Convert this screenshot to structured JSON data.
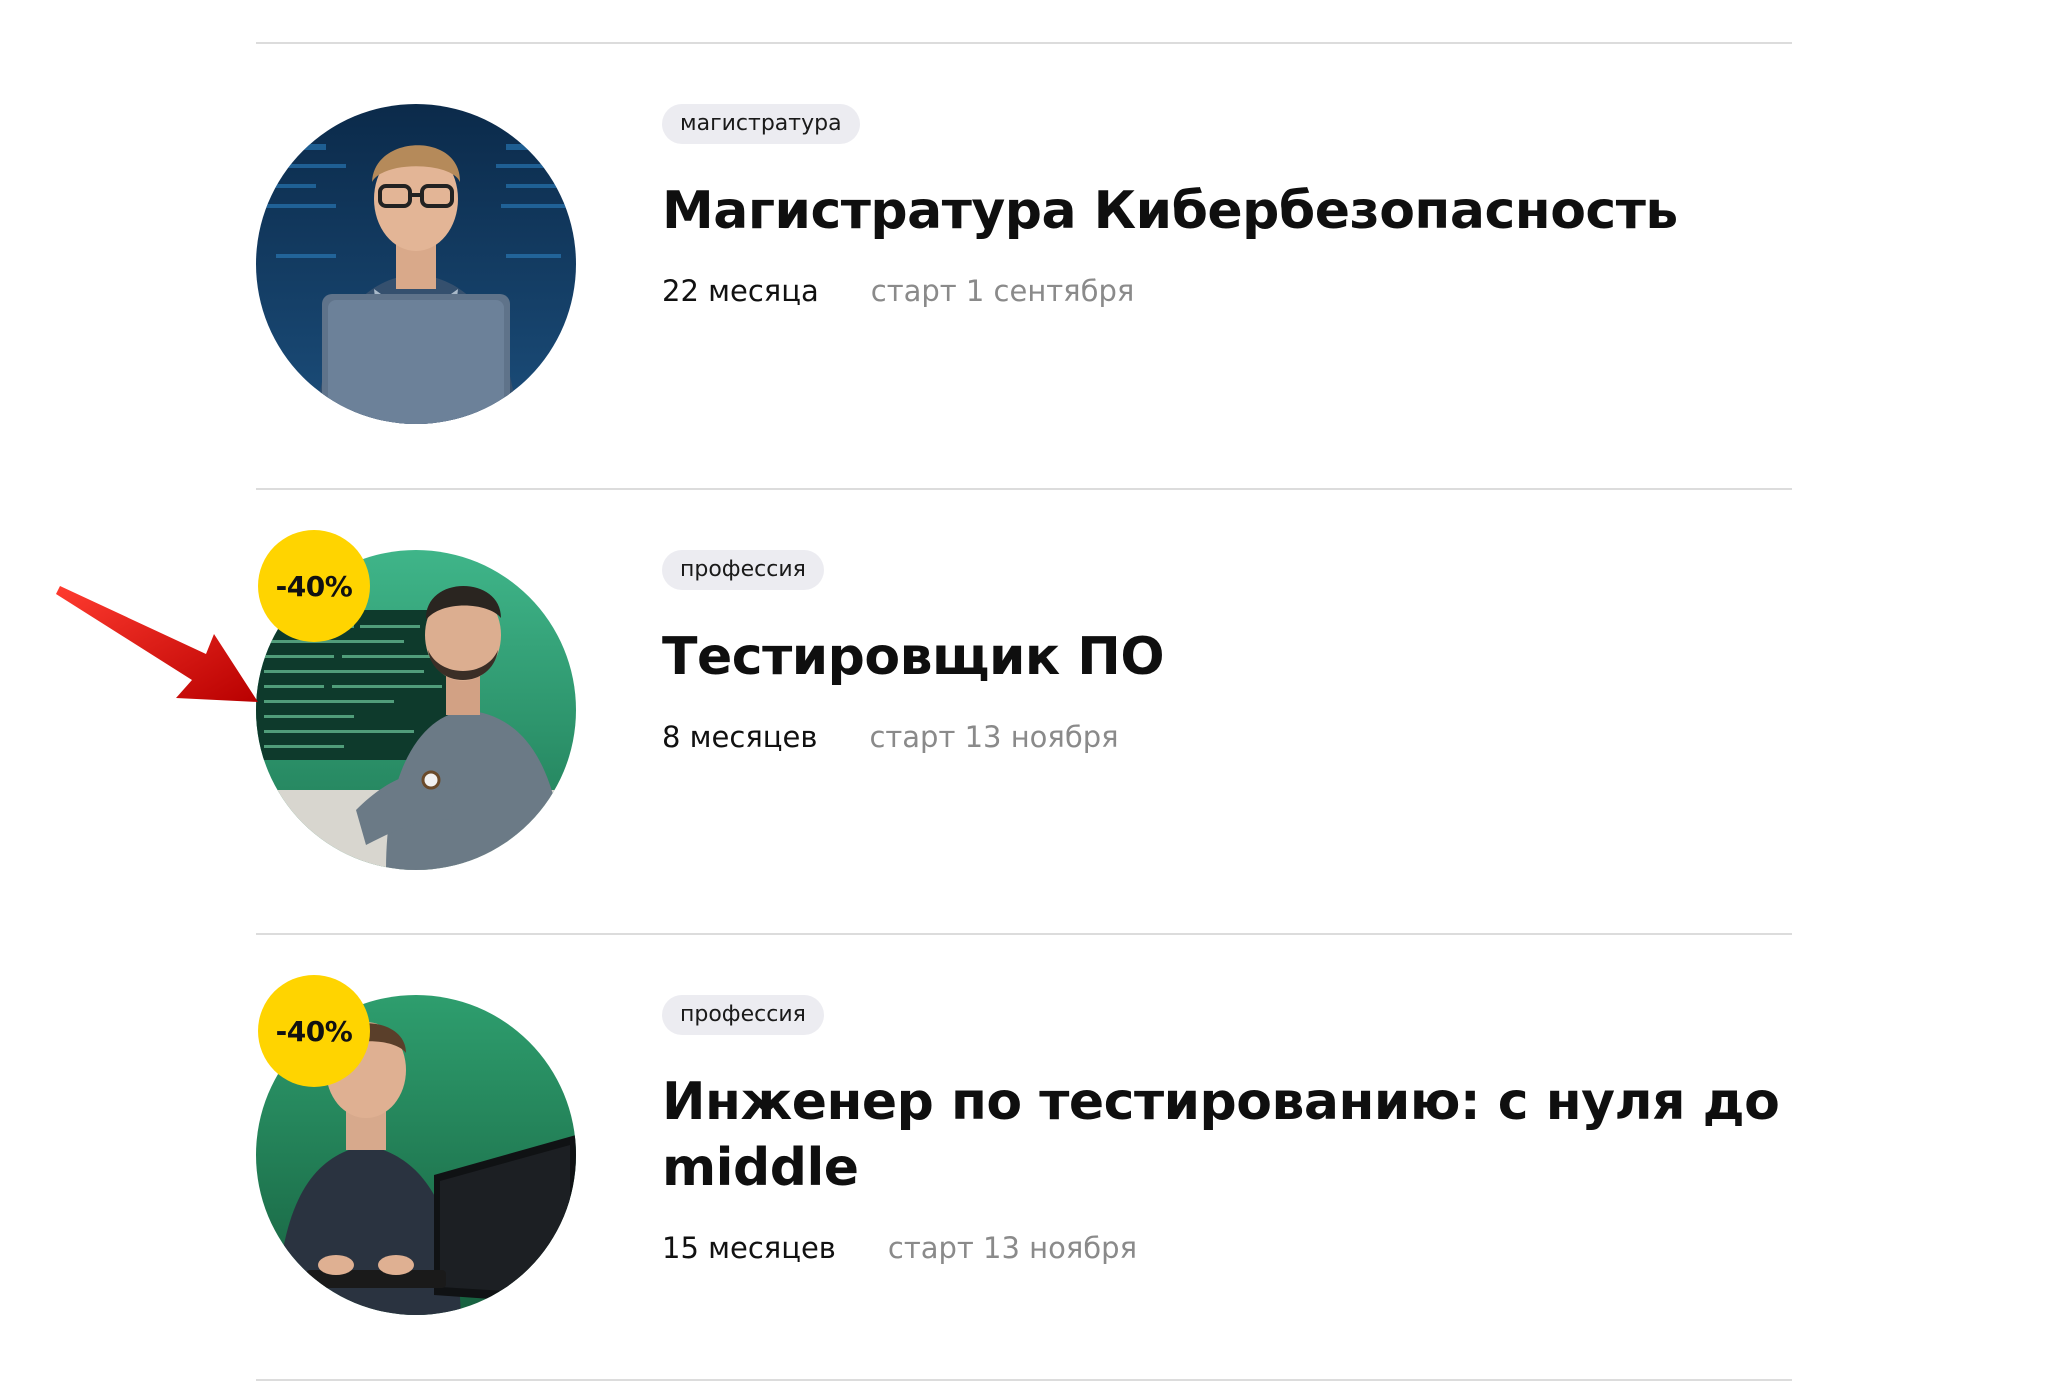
{
  "courses": [
    {
      "tag": "магистратура",
      "title": "Магистратура Кибербезопасность",
      "duration": "22 месяца",
      "start": "старт 1 сентября",
      "discount": null
    },
    {
      "tag": "профессия",
      "title": "Тестировщик ПО",
      "duration": "8 месяцев",
      "start": "старт 13 ноября",
      "discount": "-40%"
    },
    {
      "tag": "профессия",
      "title": "Инженер по тестированию: с нуля до middle",
      "duration": "15 месяцев",
      "start": "старт 13 ноября",
      "discount": "-40%"
    }
  ],
  "colors": {
    "discount_badge": "#ffd400",
    "tag_bg": "#ececf1",
    "divider": "#dcdcdc",
    "muted_text": "#8a8a8a",
    "annotation_arrow": "#e01010"
  },
  "icons": {
    "annotation": "red-arrow-icon"
  }
}
